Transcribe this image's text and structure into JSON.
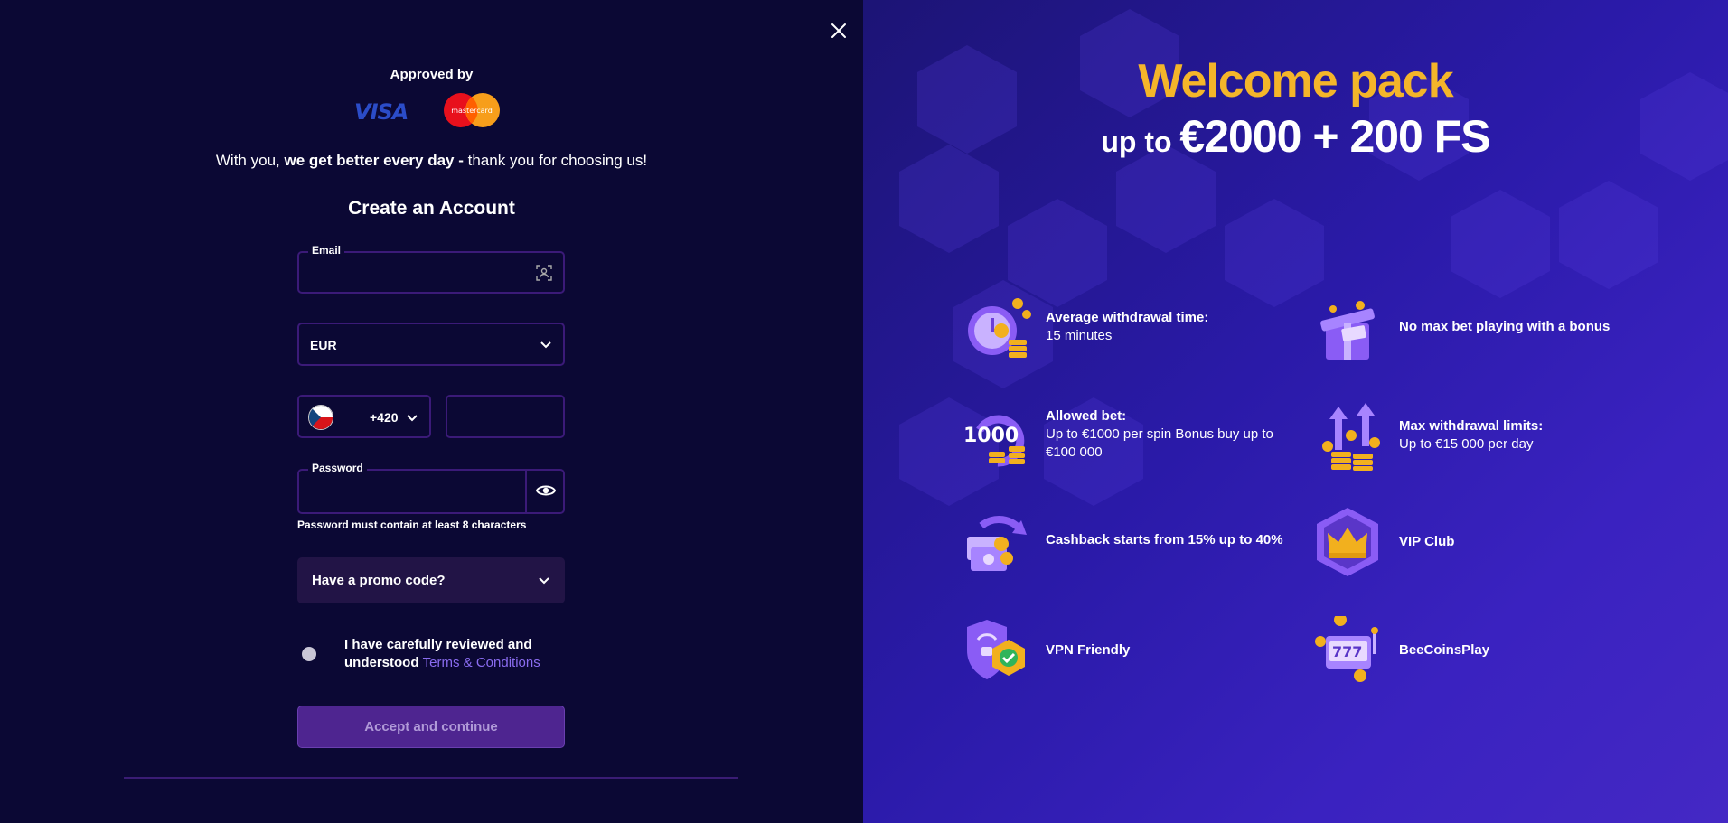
{
  "signup": {
    "approved_by": "Approved by",
    "payment_logos": {
      "visa": "VISA",
      "mastercard": "mastercard"
    },
    "tagline": {
      "pre": "With you, ",
      "bold": "we get better every day -",
      "post": " thank you for choosing us!"
    },
    "title": "Create an Account",
    "email": {
      "label": "Email",
      "value": "",
      "placeholder": ""
    },
    "currency": {
      "value": "EUR"
    },
    "phone": {
      "country_code": "+420",
      "flag": "czech-flag",
      "value": ""
    },
    "password": {
      "label": "Password",
      "value": "",
      "hint": "Password must contain at least 8 characters"
    },
    "promo": {
      "label": "Have a promo code?"
    },
    "terms": {
      "text": "I have carefully reviewed and understood ",
      "link": "Terms & Conditions",
      "checked": false
    },
    "accept_button": "Accept and continue"
  },
  "welcome": {
    "title": "Welcome pack",
    "subtitle_prefix": "up to ",
    "subtitle_amount": "€2000 + 200 FS"
  },
  "features": [
    {
      "icon": "clock-coins-icon",
      "title": "Average withdrawal time:",
      "desc": "15 minutes"
    },
    {
      "icon": "gift-box-icon",
      "title": "No max bet playing with a bonus",
      "desc": ""
    },
    {
      "icon": "bet-1000-icon",
      "title": "Allowed bet:",
      "desc": "Up to €1000 per spin Bonus buy up to €100 000"
    },
    {
      "icon": "arrows-coins-icon",
      "title": "Max withdrawal limits:",
      "desc": "Up to €15 000 per day"
    },
    {
      "icon": "cashback-icon",
      "title": "Cashback starts from 15% up to 40%",
      "desc": ""
    },
    {
      "icon": "crown-icon",
      "title": "VIP Club",
      "desc": ""
    },
    {
      "icon": "vpn-shield-icon",
      "title": "VPN Friendly",
      "desc": ""
    },
    {
      "icon": "slot-machine-icon",
      "title": "BeeCoinsPlay",
      "desc": ""
    }
  ],
  "colors": {
    "left_bg": "#0b0834",
    "accent_gold": "#f4b52a",
    "border_purple": "#3b1a78",
    "link": "#8a6cf0"
  }
}
